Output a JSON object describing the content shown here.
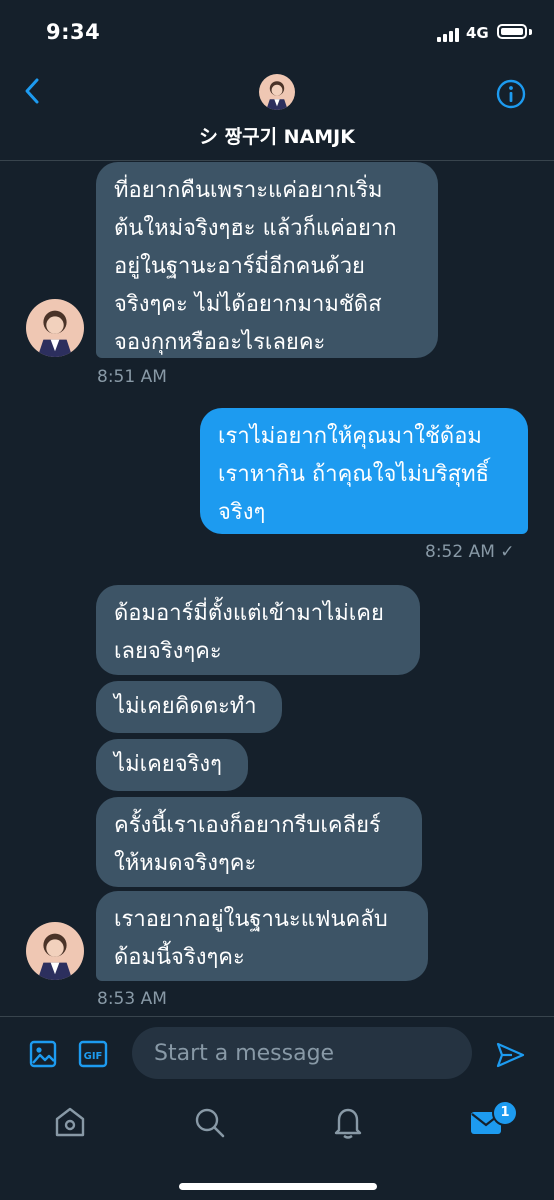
{
  "status_bar": {
    "time": "9:34",
    "network": "4G"
  },
  "header": {
    "title": "シ 짱구기 NAMJK"
  },
  "messages": [
    {
      "direction": "in",
      "text": "ที่อยากคืนเพราะแค่อยากเริ่มต้นใหม่จริงๆฮะ แล้วก็แค่อยากอยู่ในฐานะอาร์มี่อีกคนด้วยจริงๆคะ ไม่ได้อยากมามชัดิสจองกุกหรืออะไรเลยคะ",
      "lines": [
        "ที่อยากคืนเพราะแค่อยากเริ่ม",
        "ต้นใหม่จริงๆฮะ แล้วก็แค่อยาก",
        "อยู่ในฐานะอาร์มี่อีกคนด้วย",
        "จริงๆคะ ไม่ได้อยากมามชัดิส",
        "จองกุกหรืออะไรเลยคะ"
      ],
      "time": "8:51 AM"
    },
    {
      "direction": "out",
      "text": "เราไม่อยากให้คุณมาใช้ด้อมเราหากิน ถ้าคุณใจไม่บริสุทธิ์จริงๆ",
      "lines": [
        "เราไม่อยากให้คุณมาใช้ด้อม",
        "เราหากิน ถ้าคุณใจไม่บริสุทธิ์",
        "จริงๆ"
      ],
      "time": "8:52 AM ✓"
    },
    {
      "direction": "in",
      "text": "ด้อมอาร์มี่ตั้งแต่เข้ามาไม่เคยเลยจริงๆคะ",
      "lines": [
        "ด้อมอาร์มี่ตั้งแต่เข้ามาไม่เคย",
        "เลยจริงๆคะ"
      ]
    },
    {
      "direction": "in",
      "text": "ไม่เคยคิดตะทำ",
      "lines": [
        "ไม่เคยคิดตะทำ"
      ]
    },
    {
      "direction": "in",
      "text": "ไม่เคยจริงๆ",
      "lines": [
        "ไม่เคยจริงๆ"
      ]
    },
    {
      "direction": "in",
      "text": "ครั้งนี้เราเองก็อยากรีบเคลียร์ให้หมดจริงๆคะ",
      "lines": [
        "ครั้งนี้เราเองก็อยากรีบเคลียร์",
        "ให้หมดจริงๆคะ"
      ]
    },
    {
      "direction": "in",
      "text": "เราอยากอยู่ในฐานะแฟนคลับด้อมนี้จริงๆคะ",
      "lines": [
        "เราอยากอยู่ในฐานะแฟนคลับ",
        "ด้อมนี้จริงๆคะ"
      ],
      "time": "8:53 AM"
    }
  ],
  "composer": {
    "placeholder": "Start a message",
    "gif_label": "GIF"
  },
  "tabbar": {
    "items": [
      {
        "name": "home",
        "icon": "home-icon"
      },
      {
        "name": "search",
        "icon": "search-icon"
      },
      {
        "name": "notifications",
        "icon": "bell-icon"
      },
      {
        "name": "messages",
        "icon": "mail-icon",
        "active": true
      }
    ],
    "messages_badge": "1"
  },
  "colors": {
    "background": "#15202b",
    "incoming_bubble": "#3d5466",
    "outgoing_bubble": "#1d9bf0",
    "accent": "#1d9bf0",
    "muted_text": "#8899a6"
  }
}
